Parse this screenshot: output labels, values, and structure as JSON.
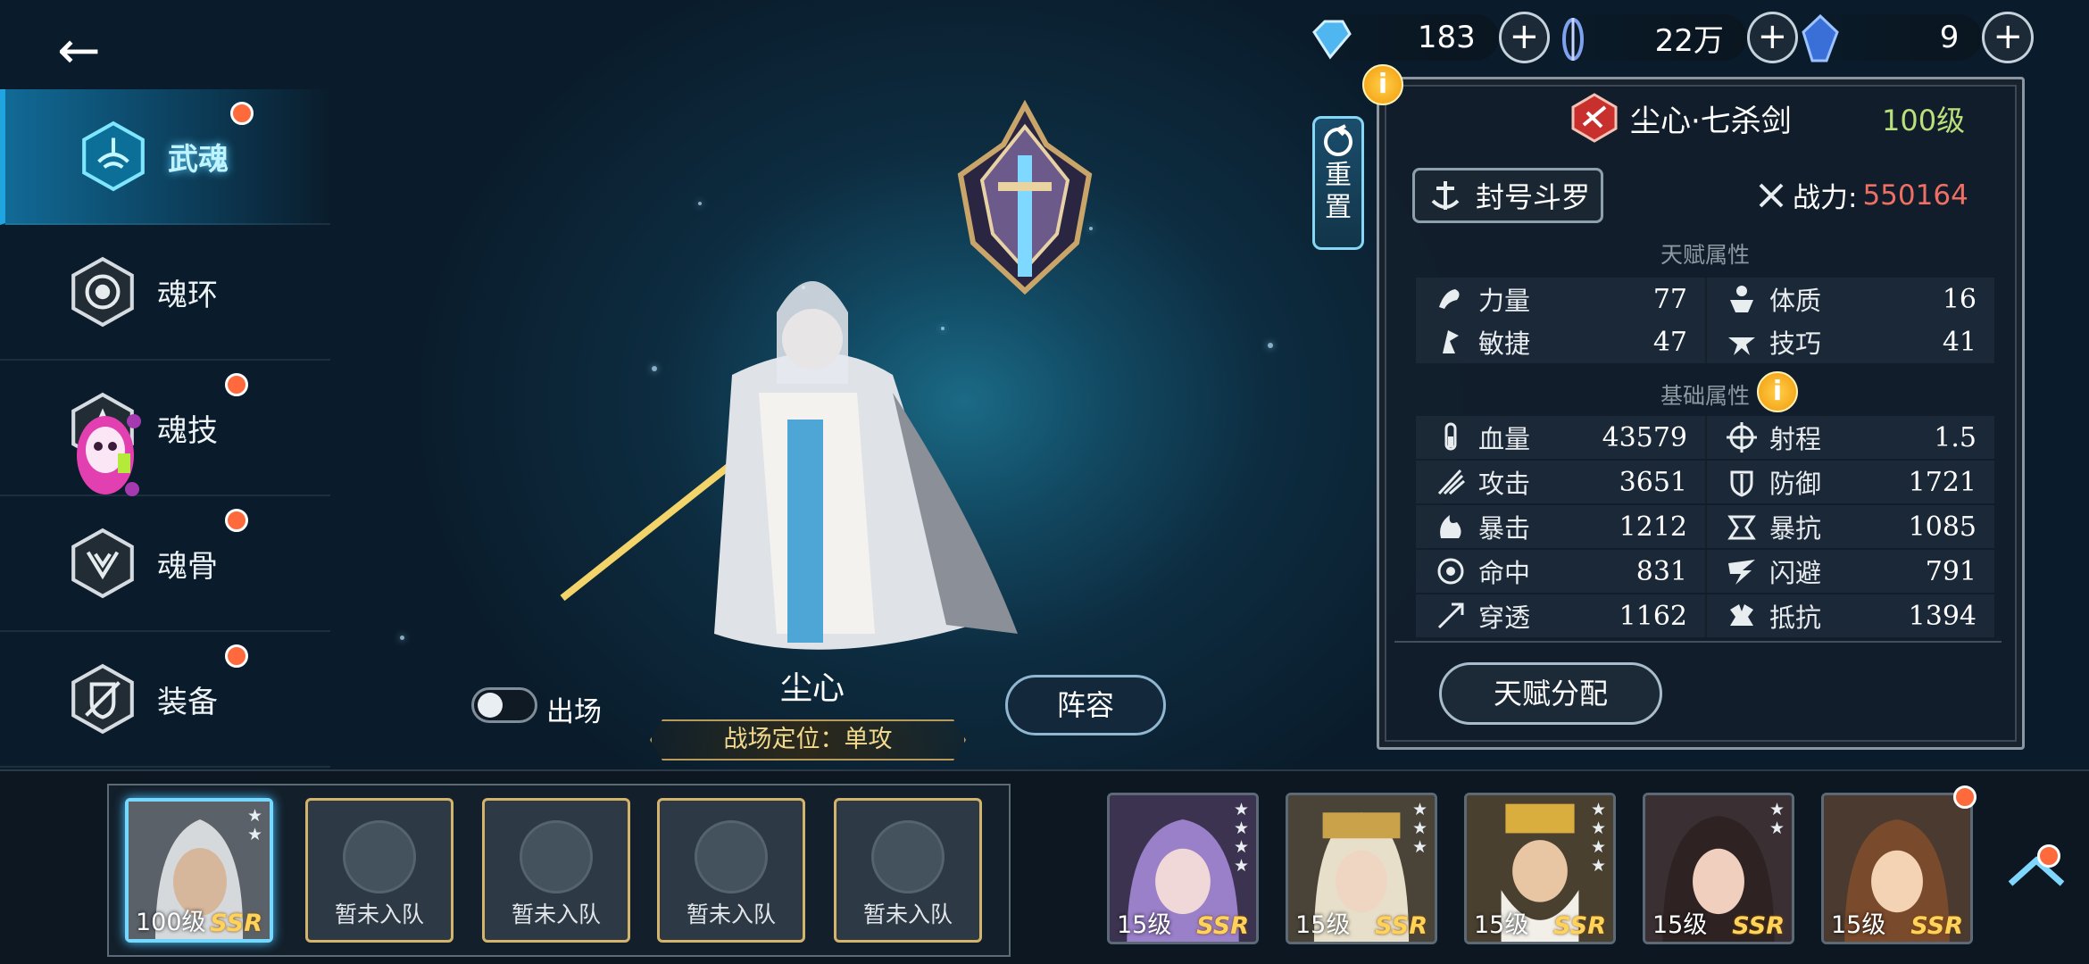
{
  "nav": {
    "back": "←",
    "items": [
      {
        "label": "武魂",
        "icon": "martial-soul-icon",
        "active": true,
        "dot": true
      },
      {
        "label": "魂环",
        "icon": "soul-ring-icon",
        "active": false,
        "dot": false
      },
      {
        "label": "魂技",
        "icon": "soul-skill-icon",
        "active": false,
        "dot": true
      },
      {
        "label": "魂骨",
        "icon": "soul-bone-icon",
        "active": false,
        "dot": true
      },
      {
        "label": "装备",
        "icon": "equipment-icon",
        "active": false,
        "dot": true
      }
    ]
  },
  "currencies": [
    {
      "icon": "diamond-icon",
      "value": "183",
      "plus": "+"
    },
    {
      "icon": "soul-coin-icon",
      "value": "22万",
      "plus": "+"
    },
    {
      "icon": "crystal-icon",
      "value": "9",
      "plus": "+"
    }
  ],
  "panel": {
    "reset_label": [
      "重",
      "置"
    ],
    "info": "i",
    "weapon_name": "尘心·七杀剑",
    "level": "100级",
    "rank_title": "封号斗罗",
    "power_label": "战力:",
    "power_value": "550164",
    "talent_section": "天赋属性",
    "talent_stats": [
      [
        {
          "name": "力量",
          "value": "77",
          "icon": "strength-icon"
        },
        {
          "name": "体质",
          "value": "16",
          "icon": "constitution-icon"
        }
      ],
      [
        {
          "name": "敏捷",
          "value": "47",
          "icon": "agility-icon"
        },
        {
          "name": "技巧",
          "value": "41",
          "icon": "skill-icon"
        }
      ]
    ],
    "base_section": "基础属性",
    "base_stats": [
      [
        {
          "name": "血量",
          "value": "43579",
          "icon": "hp-icon"
        },
        {
          "name": "射程",
          "value": "1.5",
          "icon": "range-icon"
        }
      ],
      [
        {
          "name": "攻击",
          "value": "3651",
          "icon": "attack-icon"
        },
        {
          "name": "防御",
          "value": "1721",
          "icon": "defense-icon"
        }
      ],
      [
        {
          "name": "暴击",
          "value": "1212",
          "icon": "crit-icon"
        },
        {
          "name": "暴抗",
          "value": "1085",
          "icon": "crit-resist-icon"
        }
      ],
      [
        {
          "name": "命中",
          "value": "831",
          "icon": "accuracy-icon"
        },
        {
          "name": "闪避",
          "value": "791",
          "icon": "dodge-icon"
        }
      ],
      [
        {
          "name": "穿透",
          "value": "1162",
          "icon": "penetration-icon"
        },
        {
          "name": "抵抗",
          "value": "1394",
          "icon": "resist-icon"
        }
      ]
    ],
    "talent_button": "天赋分配"
  },
  "center": {
    "deploy_label": "出场",
    "deploy_on": false,
    "hero_name": "尘心",
    "role": "战场定位：单攻",
    "lineup_button": "阵容"
  },
  "team": {
    "hero": {
      "level": "100级",
      "rarity": "SSR",
      "stars": 2
    },
    "empty_slots": [
      "暂未入队",
      "暂未入队",
      "暂未入队",
      "暂未入队"
    ]
  },
  "roster": [
    {
      "level": "15级",
      "rarity": "SSR",
      "stars": 4,
      "dot": false,
      "palette": [
        "#9a7fc9",
        "#e7c9ef"
      ]
    },
    {
      "level": "15级",
      "rarity": "SSR",
      "stars": 3,
      "dot": false,
      "palette": [
        "#c9b27a",
        "#efe6cf"
      ]
    },
    {
      "level": "15级",
      "rarity": "SSR",
      "stars": 4,
      "dot": false,
      "palette": [
        "#c8a24a",
        "#e9e6dc"
      ]
    },
    {
      "level": "15级",
      "rarity": "SSR",
      "stars": 2,
      "dot": false,
      "palette": [
        "#3a2a2a",
        "#e6c3b5"
      ]
    },
    {
      "level": "15级",
      "rarity": "SSR",
      "stars": 0,
      "dot": true,
      "palette": [
        "#7a4a2c",
        "#f0c8a8"
      ]
    }
  ],
  "colors": {
    "accent": "#1fa6e0",
    "badge": "#ff6a3d",
    "power": "#ef6f64",
    "level": "#b9e07a",
    "gold": "#ffd35a"
  }
}
